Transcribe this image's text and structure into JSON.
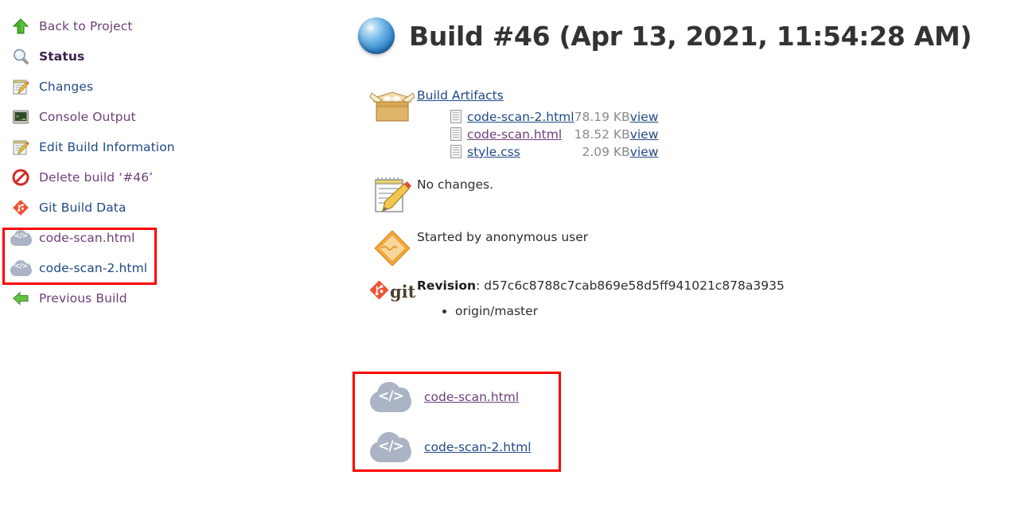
{
  "sidebar": {
    "items": [
      {
        "label": "Back to Project",
        "icon": "up-arrow-icon",
        "state": "visited"
      },
      {
        "label": "Status",
        "icon": "magnifier-icon",
        "state": "current"
      },
      {
        "label": "Changes",
        "icon": "notepad-pencil-icon",
        "state": "link"
      },
      {
        "label": "Console Output",
        "icon": "terminal-icon",
        "state": "visited"
      },
      {
        "label": "Edit Build Information",
        "icon": "notepad-pencil-icon",
        "state": "link"
      },
      {
        "label": "Delete build ‘#46’",
        "icon": "no-entry-icon",
        "state": "visited"
      },
      {
        "label": "Git Build Data",
        "icon": "git-diamond-icon",
        "state": "link"
      },
      {
        "label": "code-scan.html",
        "icon": "cloud-code-icon",
        "state": "visited"
      },
      {
        "label": "code-scan-2.html",
        "icon": "cloud-code-icon",
        "state": "link"
      },
      {
        "label": "Previous Build",
        "icon": "left-arrow-icon",
        "state": "visited"
      }
    ]
  },
  "header": {
    "title": "Build #46 (Apr 13, 2021, 11:54:28 AM)",
    "status_icon": "blue-ball-icon"
  },
  "artifacts": {
    "heading": "Build Artifacts",
    "icon": "package-box-icon",
    "columns": [
      "name",
      "size",
      "action"
    ],
    "items": [
      {
        "name": "code-scan-2.html",
        "size": "78.19 KB",
        "action": "view",
        "state": "link"
      },
      {
        "name": "code-scan.html",
        "size": "18.52 KB",
        "action": "view",
        "state": "visited"
      },
      {
        "name": "style.css",
        "size": "2.09 KB",
        "action": "view",
        "state": "link"
      }
    ]
  },
  "changes": {
    "icon": "notepad-pencil-icon",
    "text": "No changes."
  },
  "cause": {
    "icon": "orange-diamond-icon",
    "text": "Started by anonymous user"
  },
  "git": {
    "icon": "git-logo-icon",
    "logo_text": "git",
    "revision_label": "Revision",
    "revision_separator": ": ",
    "revision_hash": "d57c6c8788c7cab869e58d5ff941021c878a3935",
    "branches": [
      "origin/master"
    ]
  },
  "published_reports": {
    "items": [
      {
        "label": "code-scan.html",
        "icon": "cloud-code-icon",
        "state": "visited"
      },
      {
        "label": "code-scan-2.html",
        "icon": "cloud-code-icon",
        "state": "link"
      }
    ]
  },
  "annotations": {
    "highlight_color": "#ff0000",
    "boxes": [
      {
        "name": "sidebar-report-links-highlight"
      },
      {
        "name": "main-report-links-highlight"
      }
    ]
  }
}
